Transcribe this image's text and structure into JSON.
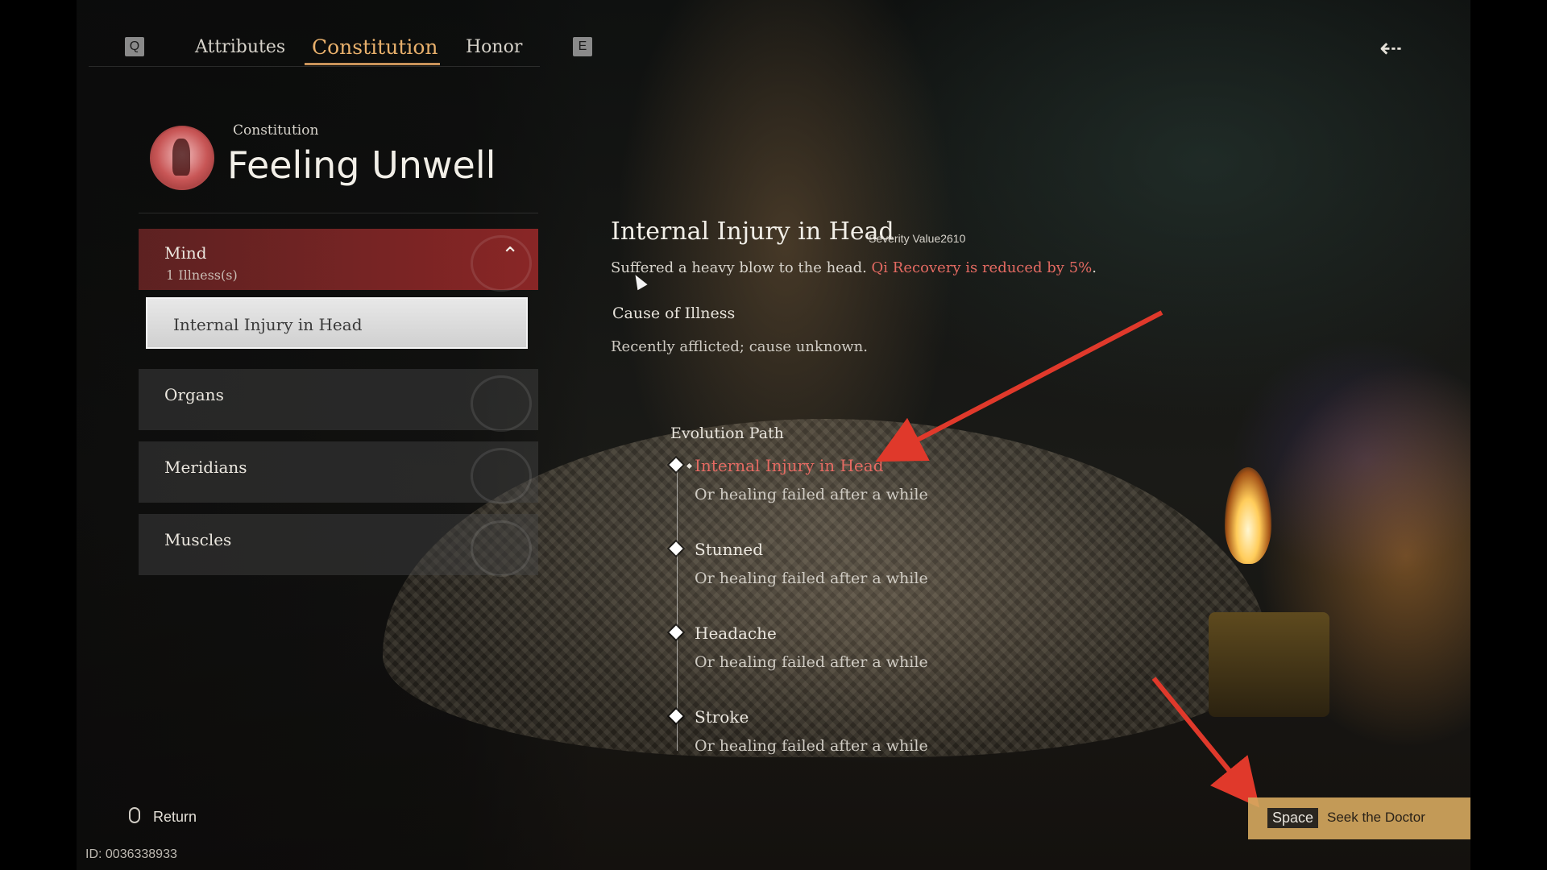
{
  "tabs": {
    "left_key": "Q",
    "right_key": "E",
    "items": [
      {
        "label": "Attributes",
        "active": false
      },
      {
        "label": "Constitution",
        "active": true
      },
      {
        "label": "Honor",
        "active": false
      }
    ]
  },
  "header": {
    "subtitle": "Constitution",
    "title": "Feeling Unwell"
  },
  "categories": [
    {
      "label": "Mind",
      "count": "1 Illness(s)",
      "expanded": true
    },
    {
      "label": "Organs"
    },
    {
      "label": "Meridians"
    },
    {
      "label": "Muscles"
    }
  ],
  "selected_illness": "Internal Injury in Head",
  "detail": {
    "title": "Internal Injury in Head",
    "severity_label": "Severity Value2610",
    "description_plain": "Suffered a heavy blow to the head.",
    "description_effect": "Qi Recovery is reduced by 5%",
    "description_end": ".",
    "cause_heading": "Cause of Illness",
    "cause_text": "Recently afflicted; cause unknown."
  },
  "evolution": {
    "heading": "Evolution Path",
    "steps": [
      {
        "name": "Internal Injury in Head",
        "note": "Or healing failed after a while",
        "current": true
      },
      {
        "name": "Stunned",
        "note": "Or healing failed after a while",
        "current": false
      },
      {
        "name": "Headache",
        "note": "Or healing failed after a while",
        "current": false
      },
      {
        "name": "Stroke",
        "note": "Or healing failed after a while",
        "current": false
      }
    ]
  },
  "footer": {
    "return_label": "Return",
    "id_label": "ID: 0036338933",
    "action_key": "Space",
    "action_label": "Seek the Doctor"
  },
  "colors": {
    "accent": "#e8b06c",
    "highlight_red": "#e46a62",
    "annotation_arrow": "#e0392b"
  }
}
